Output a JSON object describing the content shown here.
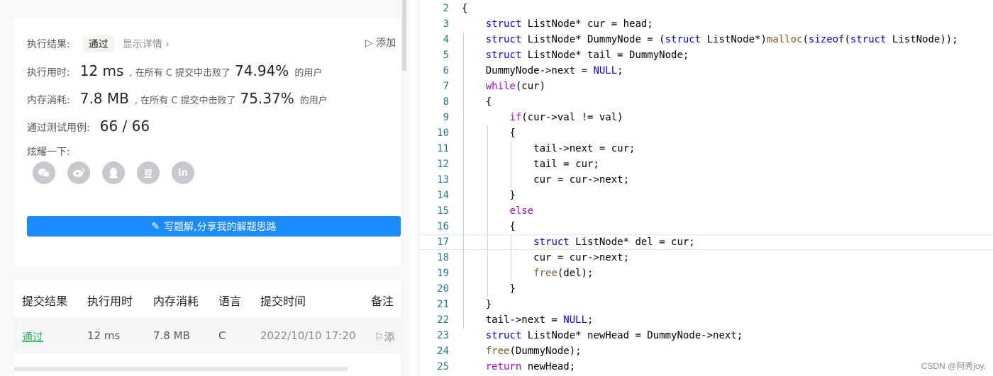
{
  "result": {
    "label": "执行结果:",
    "status": "通过",
    "detail_link": "显示详情 ›",
    "add_note": "添加"
  },
  "runtime": {
    "label": "执行用时:",
    "value": "12 ms",
    "text": ", 在所有 C 提交中击败了",
    "percent": "74.94%",
    "suffix": "的用户"
  },
  "memory": {
    "label": "内存消耗:",
    "value": "7.8 MB",
    "text": ", 在所有 C 提交中击败了",
    "percent": "75.37%",
    "suffix": "的用户"
  },
  "tests": {
    "label": "通过测试用例:",
    "value": "66 / 66"
  },
  "share": {
    "label": "炫耀一下:",
    "icons": [
      "wechat-icon",
      "weibo-icon",
      "qq-icon",
      "douban-icon",
      "linkedin-icon"
    ],
    "glyphs": [
      "",
      "",
      "",
      "豆",
      "in"
    ]
  },
  "write_button": "写题解,分享我的解题思路",
  "table": {
    "headers": [
      "提交结果",
      "执行用时",
      "内存消耗",
      "语言",
      "提交时间",
      "备注"
    ],
    "row": {
      "result": "通过",
      "runtime": "12 ms",
      "memory": "7.8 MB",
      "language": "C",
      "time": "2022/10/10 17:20",
      "note": "添"
    }
  },
  "code": {
    "line_numbers": [
      "2",
      "3",
      "4",
      "5",
      "6",
      "7",
      "8",
      "9",
      "10",
      "11",
      "12",
      "13",
      "14",
      "15",
      "16",
      "17",
      "18",
      "19",
      "20",
      "21",
      "22",
      "23",
      "24",
      "25"
    ],
    "lines": [
      "{",
      "    struct ListNode* cur = head;",
      "    struct ListNode* DummyNode = (struct ListNode*)malloc(sizeof(struct ListNode));",
      "    struct ListNode* tail = DummyNode;",
      "    DummyNode->next = NULL;",
      "    while(cur)",
      "    {",
      "        if(cur->val != val)",
      "        {",
      "            tail->next = cur;",
      "            tail = cur;",
      "            cur = cur->next;",
      "        }",
      "        else",
      "        {",
      "            struct ListNode* del = cur;",
      "            cur = cur->next;",
      "            free(del);",
      "        }",
      "    }",
      "    tail->next = NULL;",
      "    struct ListNode* newHead = DummyNode->next;",
      "    free(DummyNode);",
      "    return newHead;"
    ],
    "current_line": "17"
  },
  "watermark": "CSDN @阿秀joy."
}
